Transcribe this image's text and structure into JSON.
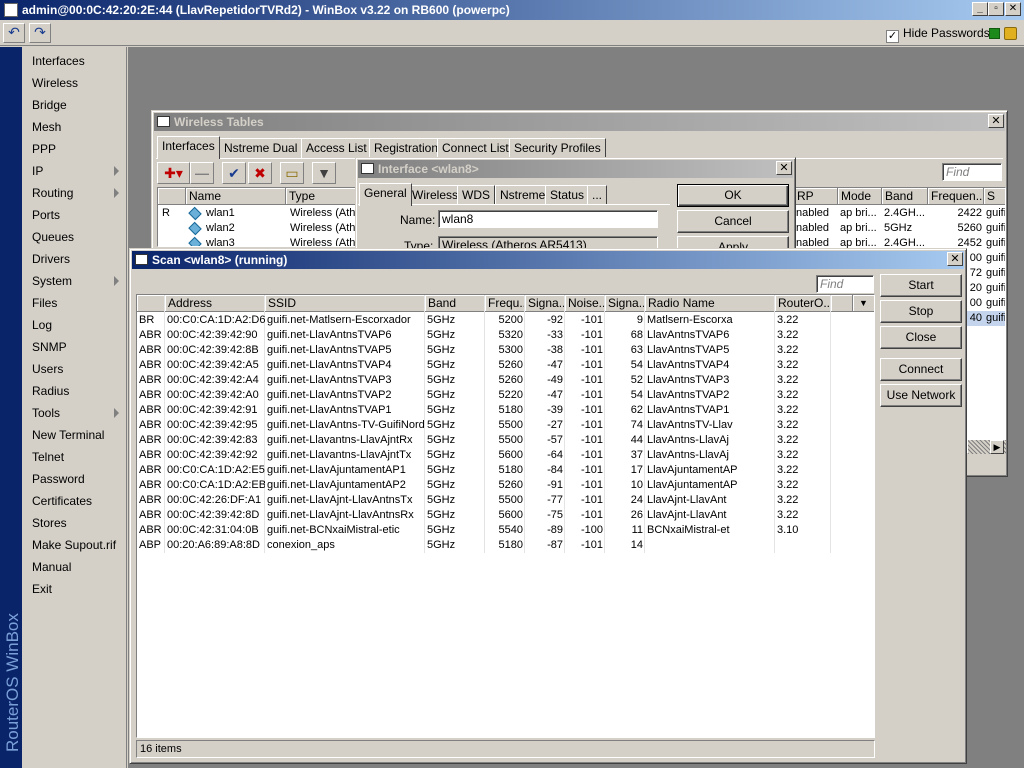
{
  "app": {
    "title": "admin@00:0C:42:20:2E:44 (LlavRepetidorTVRd2) - WinBox v3.22 on RB600 (powerpc)",
    "brand_vertical": "RouterOS WinBox",
    "hide_passwords_label": "Hide Passwords",
    "hide_passwords_checked": true,
    "accent": "#0a246a"
  },
  "toolbar": {
    "undo_icon": "undo-icon",
    "redo_icon": "redo-icon",
    "undo_glyph": "↶",
    "redo_glyph": "↷",
    "chk_glyph": "✓"
  },
  "caption_glyphs": {
    "min": "_",
    "max": "▫",
    "close": "✕"
  },
  "menu": {
    "items": [
      {
        "label": "Interfaces",
        "sub": false
      },
      {
        "label": "Wireless",
        "sub": false
      },
      {
        "label": "Bridge",
        "sub": false
      },
      {
        "label": "Mesh",
        "sub": false
      },
      {
        "label": "PPP",
        "sub": false
      },
      {
        "label": "IP",
        "sub": true
      },
      {
        "label": "Routing",
        "sub": true
      },
      {
        "label": "Ports",
        "sub": false
      },
      {
        "label": "Queues",
        "sub": false
      },
      {
        "label": "Drivers",
        "sub": false
      },
      {
        "label": "System",
        "sub": true
      },
      {
        "label": "Files",
        "sub": false
      },
      {
        "label": "Log",
        "sub": false
      },
      {
        "label": "SNMP",
        "sub": false
      },
      {
        "label": "Users",
        "sub": false
      },
      {
        "label": "Radius",
        "sub": false
      },
      {
        "label": "Tools",
        "sub": true
      },
      {
        "label": "New Terminal",
        "sub": false
      },
      {
        "label": "Telnet",
        "sub": false
      },
      {
        "label": "Password",
        "sub": false
      },
      {
        "label": "Certificates",
        "sub": false
      },
      {
        "label": "Stores",
        "sub": false
      },
      {
        "label": "Make Supout.rif",
        "sub": false
      },
      {
        "label": "Manual",
        "sub": false
      },
      {
        "label": "Exit",
        "sub": false
      }
    ]
  },
  "wireless_tables": {
    "title": "Wireless Tables",
    "tabs": [
      "Interfaces",
      "Nstreme Dual",
      "Access List",
      "Registration",
      "Connect List",
      "Security Profiles"
    ],
    "find_placeholder": "Find",
    "tool_glyphs": {
      "add": "✚▾",
      "remove": "—",
      "enable": "✔",
      "disable": "✖",
      "comment": "▭",
      "filter": "▼"
    },
    "headers_left": [
      "",
      "Name",
      "Type"
    ],
    "rows_left": [
      {
        "flag": "R",
        "name": "wlan1",
        "type": "Wireless (Athe"
      },
      {
        "flag": "",
        "name": "wlan2",
        "type": "Wireless (Athe"
      },
      {
        "flag": "",
        "name": "wlan3",
        "type": "Wireless (Athe"
      }
    ],
    "headers_right": [
      "RP",
      "Mode",
      "Band",
      "Frequen...",
      "S"
    ],
    "rows_right": [
      {
        "arp": "nabled",
        "mode": "ap bri...",
        "band": "2.4GH...",
        "freq": "2422",
        "s": "guifi"
      },
      {
        "arp": "nabled",
        "mode": "ap bri...",
        "band": "5GHz",
        "freq": "5260",
        "s": "guifi"
      },
      {
        "arp": "nabled",
        "mode": "ap bri...",
        "band": "2.4GH...",
        "freq": "2452",
        "s": "guifi"
      },
      {
        "arp": "",
        "mode": "",
        "band": "",
        "freq": "00",
        "s": "guifi"
      },
      {
        "arp": "",
        "mode": "",
        "band": "",
        "freq": "72",
        "s": "guifi"
      },
      {
        "arp": "",
        "mode": "",
        "band": "",
        "freq": "20",
        "s": "guifi"
      },
      {
        "arp": "",
        "mode": "",
        "band": "",
        "freq": "00",
        "s": "guifi"
      },
      {
        "arp": "",
        "mode": "",
        "band": "",
        "freq": "40",
        "s": "guifi"
      }
    ]
  },
  "interface_dialog": {
    "title": "Interface <wlan8>",
    "tabs": [
      "General",
      "Wireless",
      "WDS",
      "Nstreme",
      "Status",
      "..."
    ],
    "name_label": "Name:",
    "name_value": "wlan8",
    "type_label": "Type:",
    "type_value": "Wireless (Atheros AR5413)",
    "ok_label": "OK",
    "cancel_label": "Cancel",
    "apply_label": "Apply"
  },
  "scan": {
    "title": "Scan <wlan8> (running)",
    "find_placeholder": "Find",
    "buttons": {
      "start": "Start",
      "stop": "Stop",
      "close": "Close",
      "connect": "Connect",
      "use_network": "Use Network"
    },
    "headers": [
      "",
      "Address",
      "SSID",
      "Band",
      "Frequ...",
      "Signa...",
      "Noise...",
      "Signa...",
      "Radio Name",
      "RouterO..."
    ],
    "rows": [
      [
        "BR",
        "00:C0:CA:1D:A2:D6",
        "guifi.net-Matlsern-Escorxador",
        "5GHz",
        "5200",
        "-92",
        "-101",
        "9",
        "Matlsern-Escorxa",
        "3.22"
      ],
      [
        "ABR",
        "00:0C:42:39:42:90",
        "guifi.net-LlavAntnsTVAP6",
        "5GHz",
        "5320",
        "-33",
        "-101",
        "68",
        "LlavAntnsTVAP6",
        "3.22"
      ],
      [
        "ABR",
        "00:0C:42:39:42:8B",
        "guifi.net-LlavAntnsTVAP5",
        "5GHz",
        "5300",
        "-38",
        "-101",
        "63",
        "LlavAntnsTVAP5",
        "3.22"
      ],
      [
        "ABR",
        "00:0C:42:39:42:A5",
        "guifi.net-LlavAntnsTVAP4",
        "5GHz",
        "5260",
        "-47",
        "-101",
        "54",
        "LlavAntnsTVAP4",
        "3.22"
      ],
      [
        "ABR",
        "00:0C:42:39:42:A4",
        "guifi.net-LlavAntnsTVAP3",
        "5GHz",
        "5260",
        "-49",
        "-101",
        "52",
        "LlavAntnsTVAP3",
        "3.22"
      ],
      [
        "ABR",
        "00:0C:42:39:42:A0",
        "guifi.net-LlavAntnsTVAP2",
        "5GHz",
        "5220",
        "-47",
        "-101",
        "54",
        "LlavAntnsTVAP2",
        "3.22"
      ],
      [
        "ABR",
        "00:0C:42:39:42:91",
        "guifi.net-LlavAntnsTVAP1",
        "5GHz",
        "5180",
        "-39",
        "-101",
        "62",
        "LlavAntnsTVAP1",
        "3.22"
      ],
      [
        "ABR",
        "00:0C:42:39:42:95",
        "guifi.net-LlavAntns-TV-GuifiNord",
        "5GHz",
        "5500",
        "-27",
        "-101",
        "74",
        "LlavAntnsTV-Llav",
        "3.22"
      ],
      [
        "ABR",
        "00:0C:42:39:42:83",
        "guifi.net-Llavantns-LlavAjntRx",
        "5GHz",
        "5500",
        "-57",
        "-101",
        "44",
        "LlavAntns-LlavAj",
        "3.22"
      ],
      [
        "ABR",
        "00:0C:42:39:42:92",
        "guifi.net-Llavantns-LlavAjntTx",
        "5GHz",
        "5600",
        "-64",
        "-101",
        "37",
        "LlavAntns-LlavAj",
        "3.22"
      ],
      [
        "ABR",
        "00:C0:CA:1D:A2:E5",
        "guifi.net-LlavAjuntamentAP1",
        "5GHz",
        "5180",
        "-84",
        "-101",
        "17",
        "LlavAjuntamentAP",
        "3.22"
      ],
      [
        "ABR",
        "00:C0:CA:1D:A2:EB",
        "guifi.net-LlavAjuntamentAP2",
        "5GHz",
        "5260",
        "-91",
        "-101",
        "10",
        "LlavAjuntamentAP",
        "3.22"
      ],
      [
        "ABR",
        "00:0C:42:26:DF:A1",
        "guifi.net-LlavAjnt-LlavAntnsTx",
        "5GHz",
        "5500",
        "-77",
        "-101",
        "24",
        "LlavAjnt-LlavAnt",
        "3.22"
      ],
      [
        "ABR",
        "00:0C:42:39:42:8D",
        "guifi.net-LlavAjnt-LlavAntnsRx",
        "5GHz",
        "5600",
        "-75",
        "-101",
        "26",
        "LlavAjnt-LlavAnt",
        "3.22"
      ],
      [
        "ABR",
        "00:0C:42:31:04:0B",
        "guifi.net-BCNxaiMistral-etic",
        "5GHz",
        "5540",
        "-89",
        "-100",
        "11",
        "BCNxaiMistral-et",
        "3.10"
      ],
      [
        "ABP",
        "00:20:A6:89:A8:8D",
        "conexion_aps",
        "5GHz",
        "5180",
        "-87",
        "-101",
        "14",
        "",
        ""
      ]
    ],
    "status": "16 items"
  }
}
